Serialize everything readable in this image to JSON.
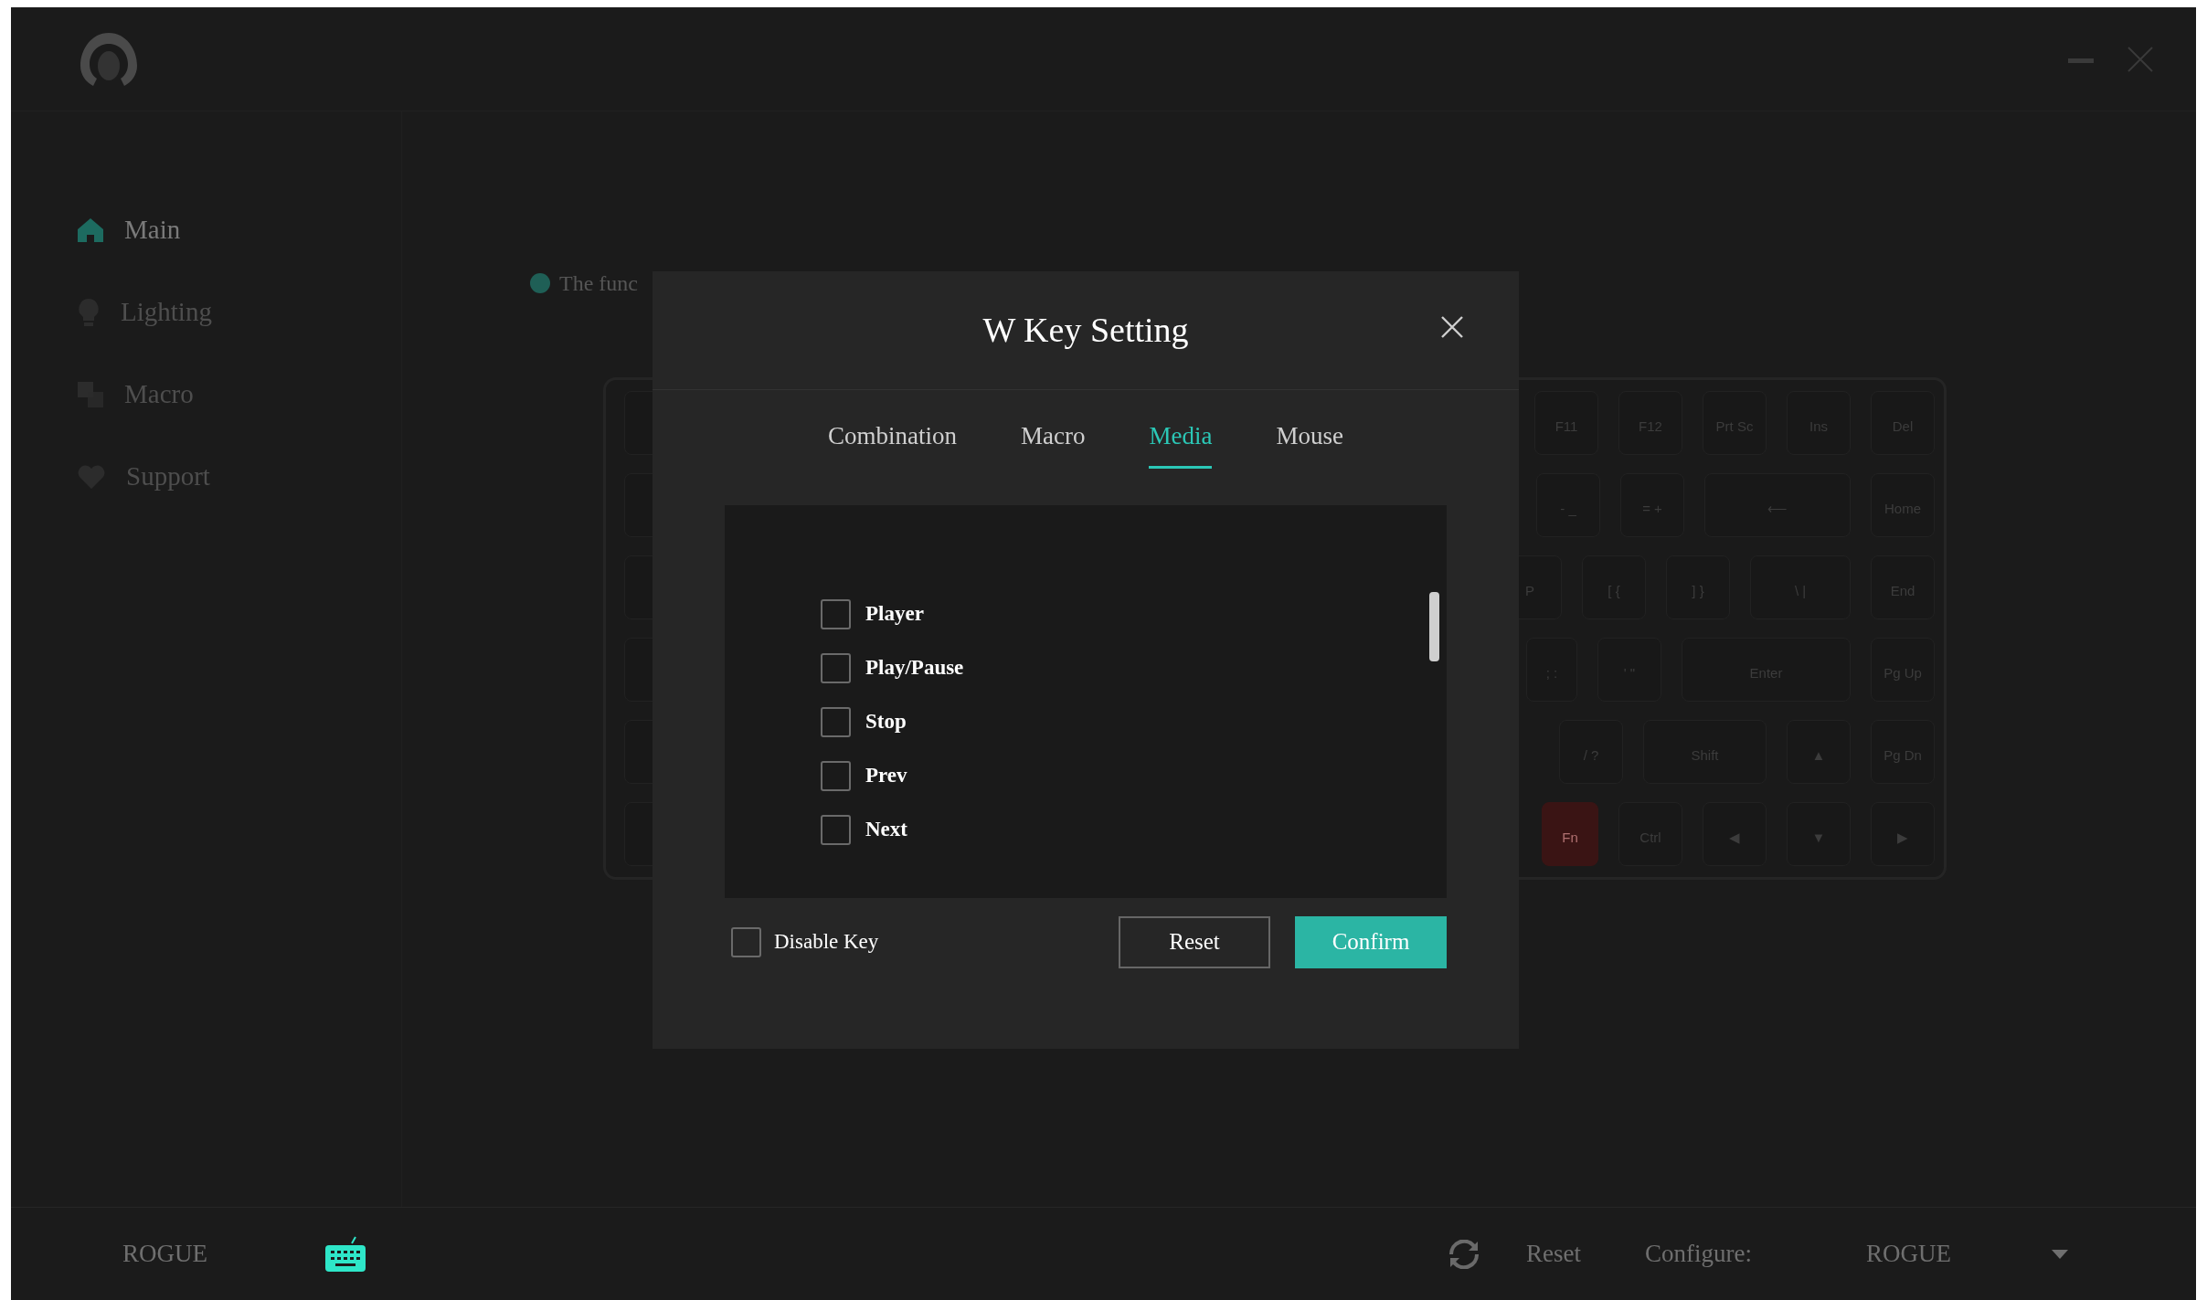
{
  "sidebar": {
    "items": [
      {
        "label": "Main",
        "selected": true
      },
      {
        "label": "Lighting",
        "selected": false
      },
      {
        "label": "Macro",
        "selected": false
      },
      {
        "label": "Support",
        "selected": false
      }
    ]
  },
  "notice": {
    "text": "The func"
  },
  "keyboard": {
    "rows": [
      [
        {
          "label": "F11",
          "kind": "key"
        },
        {
          "label": "F12",
          "kind": "key"
        },
        {
          "label": "Prt Sc",
          "kind": "key"
        },
        {
          "label": "Ins",
          "kind": "key"
        },
        {
          "label": "Del",
          "kind": "key"
        }
      ],
      [
        {
          "label": "- _",
          "kind": "key"
        },
        {
          "label": "= +",
          "kind": "key"
        },
        {
          "label": "⟵",
          "kind": "backspace"
        },
        {
          "label": "Home",
          "kind": "key"
        }
      ],
      [
        {
          "label": "P",
          "kind": "key"
        },
        {
          "label": "[ {",
          "kind": "key"
        },
        {
          "label": "] }",
          "kind": "key"
        },
        {
          "label": "\\ |",
          "kind": "backslash"
        },
        {
          "label": "End",
          "kind": "key"
        }
      ],
      [
        {
          "label": "; :",
          "kind": "short"
        },
        {
          "label": "' \"",
          "kind": "key"
        },
        {
          "label": "Enter",
          "kind": "enter"
        },
        {
          "label": "Pg Up",
          "kind": "key"
        }
      ],
      [
        {
          "label": "/ ?",
          "kind": "key"
        },
        {
          "label": "Shift",
          "kind": "shift"
        },
        {
          "label": "▲",
          "kind": "key"
        },
        {
          "label": "Pg Dn",
          "kind": "key"
        }
      ],
      [
        {
          "label": "Fn",
          "kind": "fn"
        },
        {
          "label": "Ctrl",
          "kind": "key"
        },
        {
          "label": "◀",
          "kind": "key"
        },
        {
          "label": "▼",
          "kind": "key"
        },
        {
          "label": "▶",
          "kind": "key"
        }
      ]
    ]
  },
  "dialog": {
    "title": "W Key Setting",
    "tabs": [
      {
        "label": "Combination",
        "selected": false
      },
      {
        "label": "Macro",
        "selected": false
      },
      {
        "label": "Media",
        "selected": true
      },
      {
        "label": "Mouse",
        "selected": false
      }
    ],
    "options": [
      {
        "label": "Player",
        "checked": false
      },
      {
        "label": "Play/Pause",
        "checked": false
      },
      {
        "label": "Stop",
        "checked": false
      },
      {
        "label": "Prev",
        "checked": false
      },
      {
        "label": "Next",
        "checked": false
      }
    ],
    "disable_key": {
      "label": "Disable Key",
      "checked": false
    },
    "buttons": [
      {
        "label": "Reset",
        "kind": "secondary"
      },
      {
        "label": "Confirm",
        "kind": "primary"
      }
    ]
  },
  "footer": {
    "device": "ROGUE",
    "reset": "Reset",
    "configure_label": "Configure:",
    "configure_value": "ROGUE"
  }
}
